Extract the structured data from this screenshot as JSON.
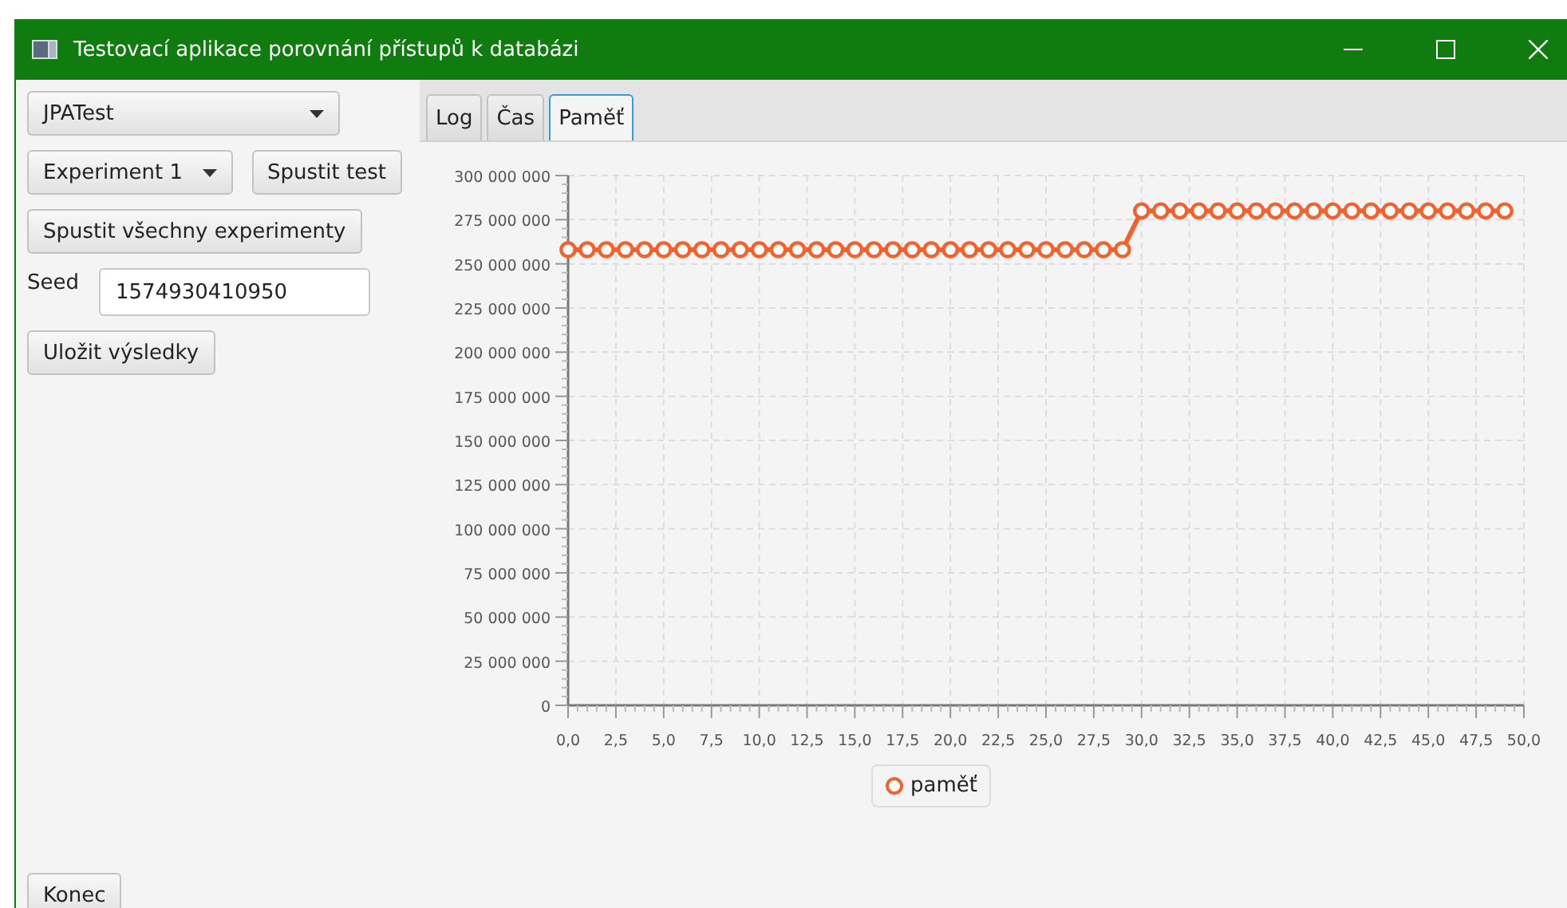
{
  "window": {
    "title": "Testovací aplikace porovnání přístupů k databázi"
  },
  "left_panel": {
    "test_select": {
      "value": "JPATest"
    },
    "experiment_select": {
      "value": "Experiment 1"
    },
    "run_test_button": "Spustit test",
    "run_all_button": "Spustit všechny experimenty",
    "seed": {
      "label": "Seed",
      "value": "1574930410950"
    },
    "save_button": "Uložit výsledky",
    "exit_button": "Konec"
  },
  "tabs": [
    {
      "label": "Log",
      "selected": false
    },
    {
      "label": "Čas",
      "selected": false
    },
    {
      "label": "Paměť",
      "selected": true
    }
  ],
  "chart": {
    "chart_data": {
      "type": "line",
      "x": [
        0,
        1,
        2,
        3,
        4,
        5,
        6,
        7,
        8,
        9,
        10,
        11,
        12,
        13,
        14,
        15,
        16,
        17,
        18,
        19,
        20,
        21,
        22,
        23,
        24,
        25,
        26,
        27,
        28,
        29,
        30,
        31,
        32,
        33,
        34,
        35,
        36,
        37,
        38,
        39,
        40,
        41,
        42,
        43,
        44,
        45,
        46,
        47,
        48,
        49
      ],
      "grid": true,
      "series": [
        {
          "name": "paměť",
          "color": "#f3622d",
          "marker": "circle",
          "values": [
            258000000,
            258000000,
            258000000,
            258000000,
            258000000,
            258000000,
            258000000,
            258000000,
            258000000,
            258000000,
            258000000,
            258000000,
            258000000,
            258000000,
            258000000,
            258000000,
            258000000,
            258000000,
            258000000,
            258000000,
            258000000,
            258000000,
            258000000,
            258000000,
            258000000,
            258000000,
            258000000,
            258000000,
            258000000,
            258000000,
            280000000,
            280000000,
            280000000,
            280000000,
            280000000,
            280000000,
            280000000,
            280000000,
            280000000,
            280000000,
            280000000,
            280000000,
            280000000,
            280000000,
            280000000,
            280000000,
            280000000,
            280000000,
            280000000,
            280000000
          ]
        }
      ],
      "xlim": [
        0,
        50
      ],
      "ylim": [
        0,
        300000000
      ],
      "xticks": [
        {
          "value": 0,
          "label": "0,0"
        },
        {
          "value": 2.5,
          "label": "2,5"
        },
        {
          "value": 5,
          "label": "5,0"
        },
        {
          "value": 7.5,
          "label": "7,5"
        },
        {
          "value": 10,
          "label": "10,0"
        },
        {
          "value": 12.5,
          "label": "12,5"
        },
        {
          "value": 15,
          "label": "15,0"
        },
        {
          "value": 17.5,
          "label": "17,5"
        },
        {
          "value": 20,
          "label": "20,0"
        },
        {
          "value": 22.5,
          "label": "22,5"
        },
        {
          "value": 25,
          "label": "25,0"
        },
        {
          "value": 27.5,
          "label": "27,5"
        },
        {
          "value": 30,
          "label": "30,0"
        },
        {
          "value": 32.5,
          "label": "32,5"
        },
        {
          "value": 35,
          "label": "35,0"
        },
        {
          "value": 37.5,
          "label": "37,5"
        },
        {
          "value": 40,
          "label": "40,0"
        },
        {
          "value": 42.5,
          "label": "42,5"
        },
        {
          "value": 45,
          "label": "45,0"
        },
        {
          "value": 47.5,
          "label": "47,5"
        },
        {
          "value": 50,
          "label": "50,0"
        }
      ],
      "yticks": [
        {
          "value": 0,
          "label": "0"
        },
        {
          "value": 25000000,
          "label": "25 000 000"
        },
        {
          "value": 50000000,
          "label": "50 000 000"
        },
        {
          "value": 75000000,
          "label": "75 000 000"
        },
        {
          "value": 100000000,
          "label": "100 000 000"
        },
        {
          "value": 125000000,
          "label": "125 000 000"
        },
        {
          "value": 150000000,
          "label": "150 000 000"
        },
        {
          "value": 175000000,
          "label": "175 000 000"
        },
        {
          "value": 200000000,
          "label": "200 000 000"
        },
        {
          "value": 225000000,
          "label": "225 000 000"
        },
        {
          "value": 250000000,
          "label": "250 000 000"
        },
        {
          "value": 275000000,
          "label": "275 000 000"
        },
        {
          "value": 300000000,
          "label": "300 000 000"
        }
      ]
    }
  }
}
